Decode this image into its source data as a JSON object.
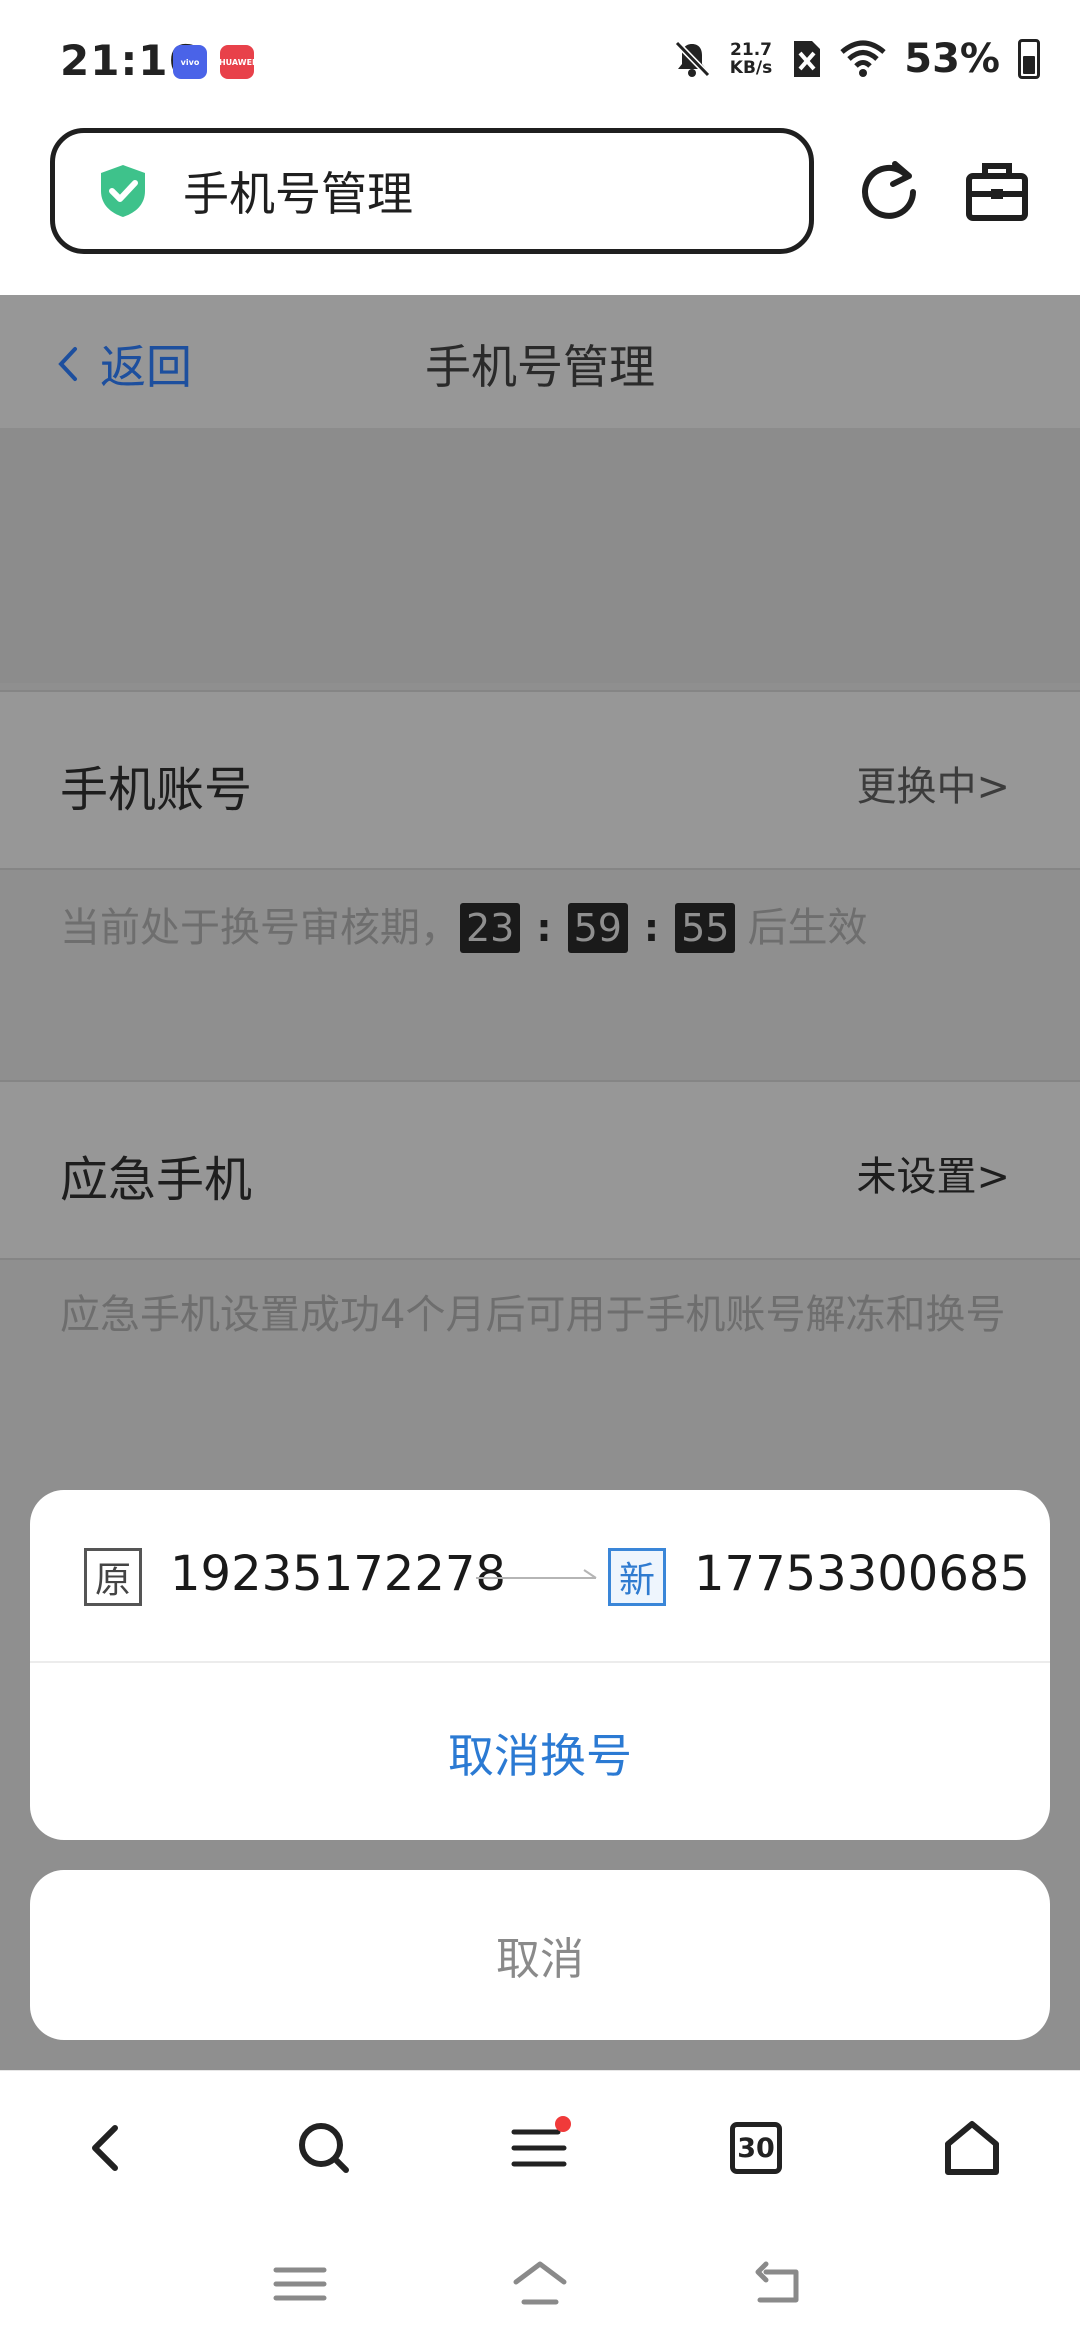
{
  "status_bar": {
    "time": "21:16",
    "badges": [
      "vivo",
      "HUAWEI"
    ],
    "net_speed_value": "21.7",
    "net_speed_unit": "KB/s",
    "battery": "53%",
    "battery_level": 0.53,
    "icons": [
      "bell-muted-icon",
      "sim-off-icon",
      "wifi-icon",
      "battery-icon"
    ]
  },
  "top_bar": {
    "page_title": "手机号管理",
    "icons": [
      "shield-check-icon",
      "refresh-icon",
      "toolbox-icon"
    ]
  },
  "header": {
    "back_label": "返回",
    "title": "手机号管理"
  },
  "phone_account": {
    "label": "手机账号",
    "status": "更换中",
    "note_prefix": "当前处于换号审核期，",
    "countdown": {
      "hours": "23",
      "minutes": "59",
      "seconds": "55"
    },
    "separator": ":",
    "note_suffix": "后生效"
  },
  "emergency_phone": {
    "label": "应急手机",
    "status": "未设置",
    "note": "应急手机设置成功4个月后可用于手机账号解冻和换号"
  },
  "chevron": ">",
  "sheet": {
    "old_tag": "原",
    "old_number": "19235172278",
    "new_tag": "新",
    "new_number": "17753300685",
    "cancel_swap_label": "取消换号",
    "cancel_label": "取消"
  },
  "bottom_nav": {
    "tab_count": "30",
    "icons": [
      "back-icon",
      "search-icon",
      "menu-icon",
      "tabs-icon",
      "home-icon"
    ],
    "notification_color": "#f03a3a"
  },
  "colors": {
    "link_blue": "#2b7ad3",
    "shield_green": "#3ec28b"
  }
}
